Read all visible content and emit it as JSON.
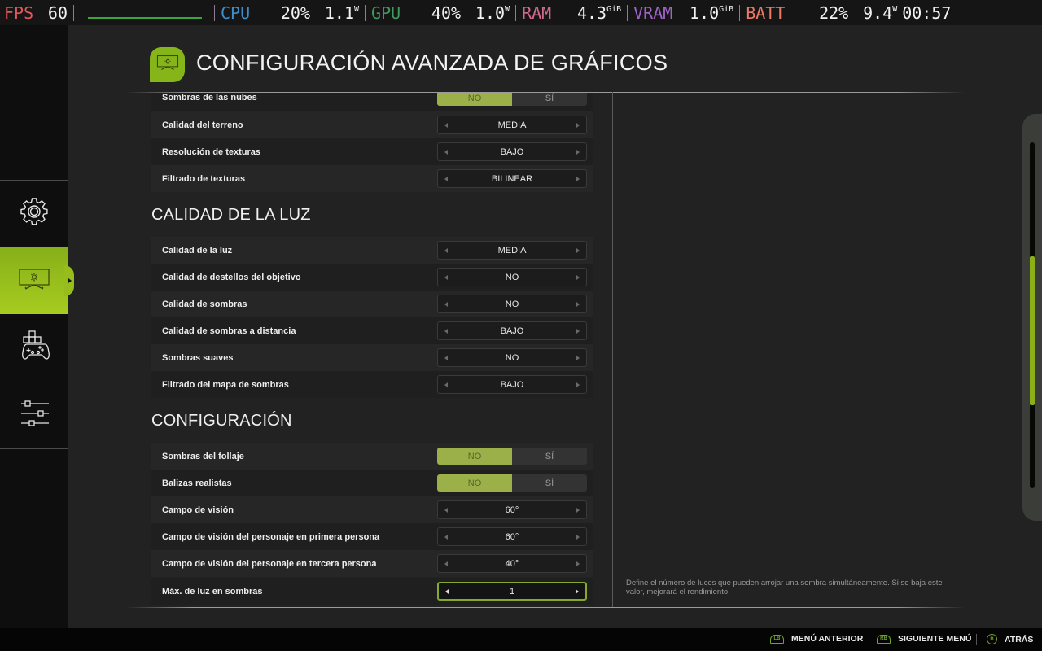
{
  "overlay": {
    "fps_label": "FPS",
    "fps_value": "60",
    "cpu_label": "CPU",
    "cpu_percent": "20%",
    "cpu_power": "1.1",
    "cpu_power_unit": "W",
    "gpu_label": "GPU",
    "gpu_percent": "40%",
    "gpu_power": "1.0",
    "gpu_power_unit": "W",
    "ram_label": "RAM",
    "ram_value": "4.3",
    "ram_unit": "GiB",
    "vram_label": "VRAM",
    "vram_value": "1.0",
    "vram_unit": "GiB",
    "batt_label": "BATT",
    "batt_percent": "22%",
    "batt_power": "9.4",
    "batt_power_unit": "W",
    "clock": "00:57"
  },
  "sidebar": {
    "items": [
      {
        "icon": "gear-icon",
        "active": false
      },
      {
        "icon": "display-settings-icon",
        "active": true
      },
      {
        "icon": "controller-icon",
        "active": false
      },
      {
        "icon": "sliders-icon",
        "active": false
      }
    ]
  },
  "header": {
    "icon": "display-settings-icon",
    "title": "CONFIGURACIÓN AVANZADA DE GRÁFICOS"
  },
  "sections": {
    "top": {
      "rows": [
        {
          "label": "Sombras de las nubes",
          "type": "toggle",
          "options": [
            "NO",
            "SÍ"
          ],
          "selected": "NO"
        },
        {
          "label": "Calidad del terreno",
          "type": "selector",
          "value": "MEDIA"
        },
        {
          "label": "Resolución de texturas",
          "type": "selector",
          "value": "BAJO"
        },
        {
          "label": "Filtrado de texturas",
          "type": "selector",
          "value": "BILINEAR"
        }
      ]
    },
    "light": {
      "title": "CALIDAD DE LA LUZ",
      "rows": [
        {
          "label": "Calidad de la luz",
          "type": "selector",
          "value": "MEDIA"
        },
        {
          "label": "Calidad de destellos del objetivo",
          "type": "selector",
          "value": "NO"
        },
        {
          "label": "Calidad de sombras",
          "type": "selector",
          "value": "NO"
        },
        {
          "label": "Calidad de sombras a distancia",
          "type": "selector",
          "value": "BAJO"
        },
        {
          "label": "Sombras suaves",
          "type": "selector",
          "value": "NO"
        },
        {
          "label": "Filtrado del mapa de sombras",
          "type": "selector",
          "value": "BAJO"
        }
      ]
    },
    "config": {
      "title": "CONFIGURACIÓN",
      "rows": [
        {
          "label": "Sombras del follaje",
          "type": "toggle",
          "options": [
            "NO",
            "SÍ"
          ],
          "selected": "NO"
        },
        {
          "label": "Balizas realistas",
          "type": "toggle",
          "options": [
            "NO",
            "SÍ"
          ],
          "selected": "NO"
        },
        {
          "label": "Campo de visión",
          "type": "selector",
          "value": "60°"
        },
        {
          "label": "Campo de visión del personaje en primera persona",
          "type": "selector",
          "value": "60°"
        },
        {
          "label": "Campo de visión del personaje en tercera persona",
          "type": "selector",
          "value": "40°"
        },
        {
          "label": "Máx. de luz en sombras",
          "type": "selector",
          "value": "1",
          "focused": true
        }
      ]
    }
  },
  "description": "Define el número de luces que pueden arrojar una sombra simultáneamente. Si se baja este valor, mejorará el rendimiento.",
  "scrollbar": {
    "thumb_start": 0.33,
    "thumb_end": 0.76
  },
  "footer": {
    "hints": [
      {
        "button": "LB",
        "label": "MENÚ ANTERIOR"
      },
      {
        "button": "RB",
        "label": "SIGUIENTE MENÚ"
      },
      {
        "button": "B",
        "label": "ATRÁS"
      }
    ]
  },
  "colors": {
    "accent": "#86b51a",
    "toggle_on": "#9cb04a",
    "focus_border": "#86a82c"
  }
}
